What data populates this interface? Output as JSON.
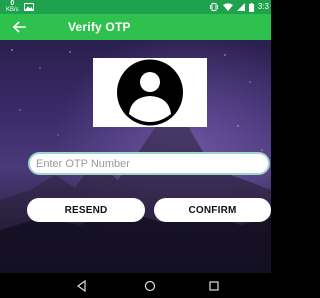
{
  "status_bar": {
    "data_rate_value": "0",
    "data_rate_unit": "KB/s",
    "time": "3:3",
    "icons": [
      "signal-data-icon",
      "image-notification-icon",
      "vibrate-icon",
      "wifi-icon",
      "cell-signal-icon",
      "battery-icon"
    ]
  },
  "app_bar": {
    "title": "Verify OTP",
    "back_icon": "back-arrow-icon"
  },
  "avatar": {
    "icon": "user-avatar-icon"
  },
  "otp_input": {
    "placeholder": "Enter OTP Number",
    "value": ""
  },
  "buttons": {
    "resend_label": "RESEND",
    "confirm_label": "CONFIRM"
  },
  "nav_bar": {
    "icons": [
      "nav-back-icon",
      "nav-home-icon",
      "nav-recent-icon"
    ]
  },
  "colors": {
    "status_bar": "#1ea24d",
    "app_bar": "#2fc14e",
    "input_border": "#9fd6c9",
    "button_bg": "#ffffff"
  }
}
